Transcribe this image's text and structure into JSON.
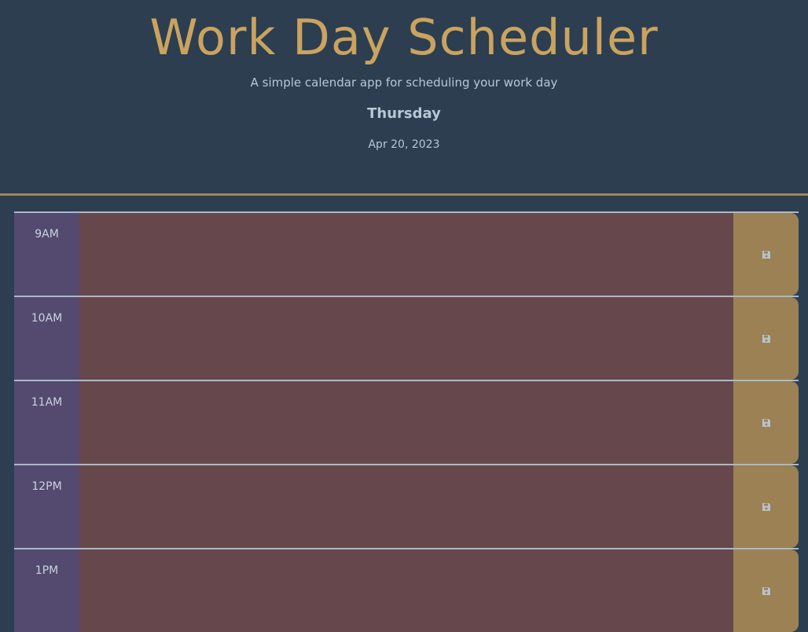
{
  "header": {
    "title": "Work Day Scheduler",
    "subtitle": "A simple calendar app for scheduling your work day",
    "day": "Thursday",
    "date": "Apr 20, 2023"
  },
  "rows": [
    {
      "hour": "9AM",
      "text": "",
      "state": "past"
    },
    {
      "hour": "10AM",
      "text": "",
      "state": "past"
    },
    {
      "hour": "11AM",
      "text": "",
      "state": "past"
    },
    {
      "hour": "12PM",
      "text": "",
      "state": "past"
    },
    {
      "hour": "1PM",
      "text": "",
      "state": "past"
    }
  ],
  "save_icon": "floppy-disk-icon",
  "colors": {
    "background": "#2c3e50",
    "title": "#caa35f",
    "hour_cell": "#544a6f",
    "past_row": "#66484c",
    "save_button": "#9b8154",
    "rule": "#a2865a"
  }
}
